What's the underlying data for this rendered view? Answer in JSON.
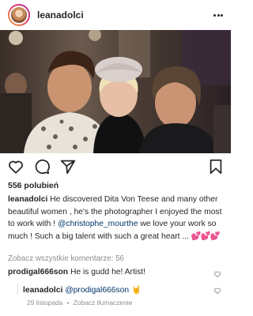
{
  "header": {
    "username": "leanadolci",
    "avatar_icon": "avatar",
    "more_icon": "more-horizontal-icon"
  },
  "photo": {
    "description_icon": "post-photo"
  },
  "actions": {
    "like_icon": "heart-icon",
    "comment_icon": "comment-icon",
    "share_icon": "send-icon",
    "save_icon": "bookmark-icon"
  },
  "likes": "556 polubień",
  "caption": {
    "user": "leanadolci",
    "text_1": "He discovered Dita Von Teese and many other beautiful women , he's the photographer I enjoyed the most to work with !",
    "mention": "@christophe_mourthe",
    "text_2": "we love your work so much ! Such a big talent with such a great heart ...",
    "hearts": "💕💕💕"
  },
  "view_all_comments": "Zobacz wszystkie komentarze: 56",
  "comments": [
    {
      "user": "prodigal666son",
      "text": "He is gudd he! Artist!"
    }
  ],
  "reply": {
    "user": "leanadolci",
    "mention": "@prodigal666son",
    "emoji": "🤘"
  },
  "meta": {
    "date": "29 listopada",
    "separator": "•",
    "translate": "Zobacz tłumaczenie"
  },
  "colors": {
    "text": "#262626",
    "secondary": "#8e8e8e",
    "link": "#003569",
    "heart": "#d0203b"
  }
}
